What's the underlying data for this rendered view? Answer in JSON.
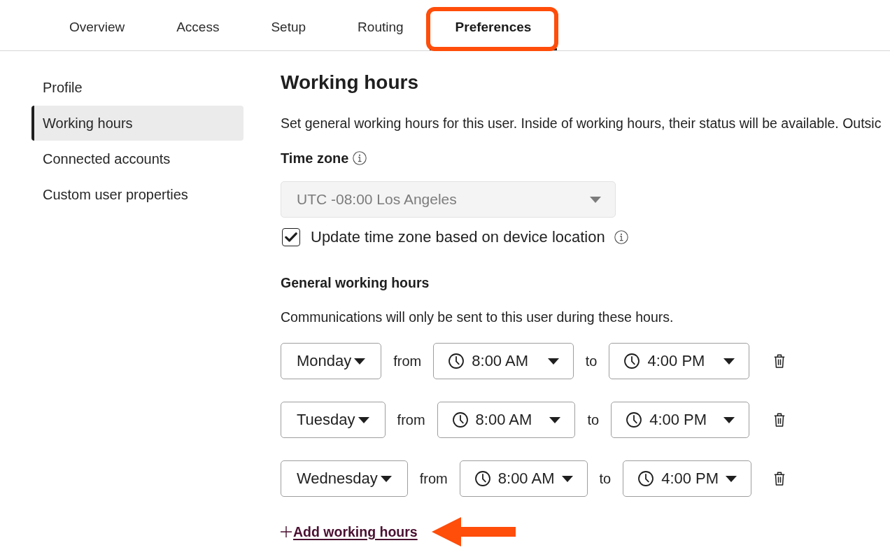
{
  "tabs": [
    {
      "label": "Overview",
      "selected": false,
      "highlighted": false
    },
    {
      "label": "Access",
      "selected": false,
      "highlighted": false
    },
    {
      "label": "Setup",
      "selected": false,
      "highlighted": false
    },
    {
      "label": "Routing",
      "selected": false,
      "highlighted": false
    },
    {
      "label": "Preferences",
      "selected": true,
      "highlighted": true
    }
  ],
  "sidebar": {
    "items": [
      {
        "label": "Profile",
        "selected": false
      },
      {
        "label": "Working hours",
        "selected": true
      },
      {
        "label": "Connected accounts",
        "selected": false
      },
      {
        "label": "Custom user properties",
        "selected": false
      }
    ]
  },
  "main": {
    "title": "Working hours",
    "description": "Set general working hours for this user. Inside of working hours, their status will be available. Outsic",
    "time_zone": {
      "label": "Time zone",
      "value": "UTC -08:00 Los Angeles",
      "disabled": true
    },
    "device_location": {
      "label": "Update time zone based on device location",
      "checked": true
    },
    "general": {
      "title": "General working hours",
      "description": "Communications will only be sent to this user during these hours.",
      "rows": [
        {
          "day": "Monday",
          "from_label": "from",
          "start": "8:00 AM",
          "to_label": "to",
          "end": "4:00 PM"
        },
        {
          "day": "Tuesday",
          "from_label": "from",
          "start": "8:00 AM",
          "to_label": "to",
          "end": "4:00 PM"
        },
        {
          "day": "Wednesday",
          "from_label": "from",
          "start": "8:00 AM",
          "to_label": "to",
          "end": "4:00 PM"
        }
      ]
    },
    "add_link": {
      "label": "Add working hours",
      "highlighted": true
    }
  }
}
